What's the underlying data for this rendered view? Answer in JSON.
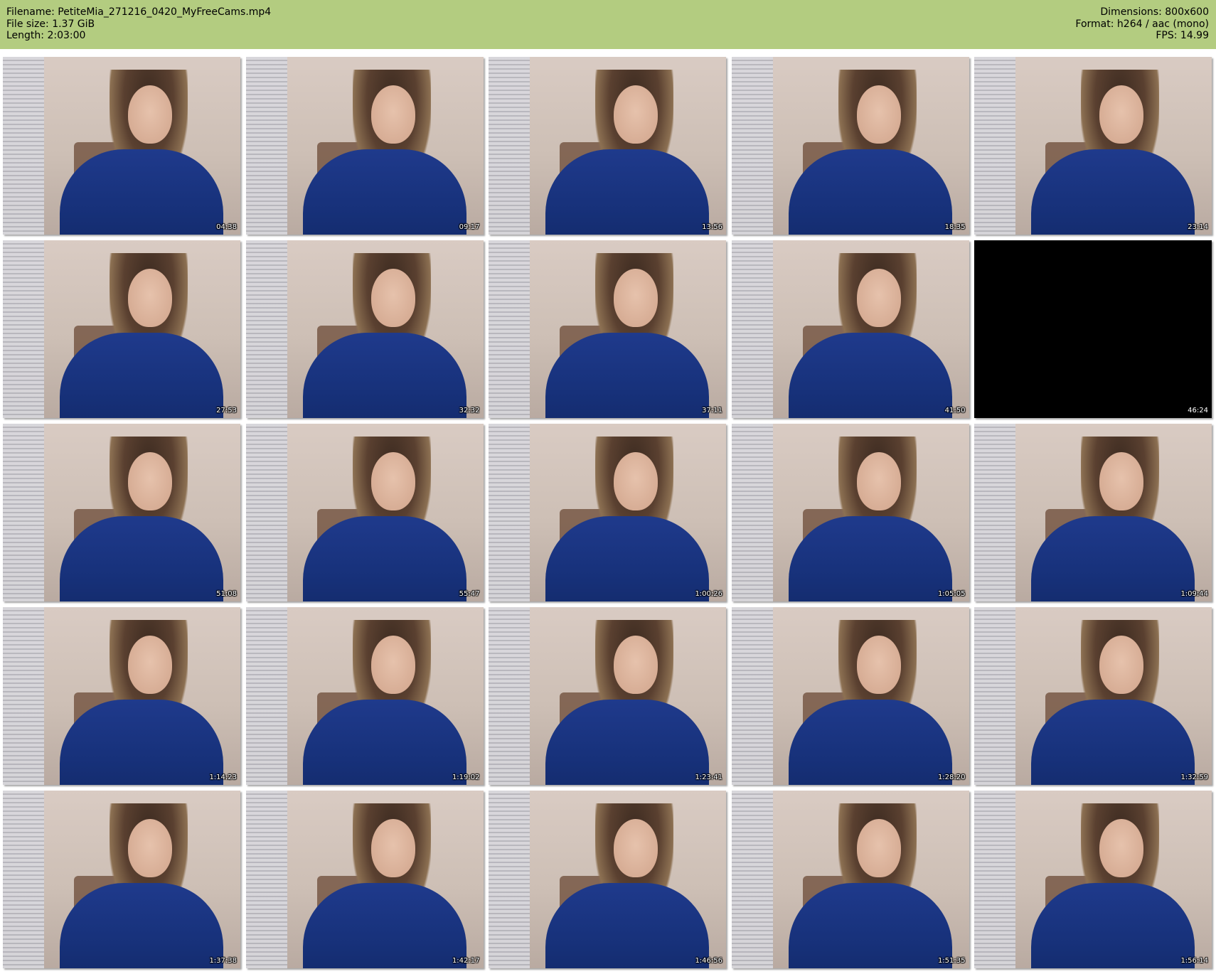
{
  "header": {
    "filename_label": "Filename: PetiteMia_271216_0420_MyFreeCams.mp4",
    "filesize_label": "File size: 1.37 GiB",
    "length_label": "Length: 2:03:00",
    "dimensions_label": "Dimensions: 800x600",
    "format_label": "Format: h264 / aac (mono)",
    "fps_label": "FPS: 14.99"
  },
  "colors": {
    "header_bg": "#b3cc80",
    "page_bg": "#ffffff"
  },
  "thumbnails": [
    {
      "timestamp": "04:38",
      "black": false
    },
    {
      "timestamp": "09:17",
      "black": false
    },
    {
      "timestamp": "13:56",
      "black": false
    },
    {
      "timestamp": "18:35",
      "black": false
    },
    {
      "timestamp": "23:14",
      "black": false
    },
    {
      "timestamp": "27:53",
      "black": false
    },
    {
      "timestamp": "32:32",
      "black": false
    },
    {
      "timestamp": "37:11",
      "black": false
    },
    {
      "timestamp": "41:50",
      "black": false
    },
    {
      "timestamp": "46:24",
      "black": true
    },
    {
      "timestamp": "51:08",
      "black": false
    },
    {
      "timestamp": "55:47",
      "black": false
    },
    {
      "timestamp": "1:00:26",
      "black": false
    },
    {
      "timestamp": "1:05:05",
      "black": false
    },
    {
      "timestamp": "1:09:44",
      "black": false
    },
    {
      "timestamp": "1:14:23",
      "black": false
    },
    {
      "timestamp": "1:19:02",
      "black": false
    },
    {
      "timestamp": "1:23:41",
      "black": false
    },
    {
      "timestamp": "1:28:20",
      "black": false
    },
    {
      "timestamp": "1:32:59",
      "black": false
    },
    {
      "timestamp": "1:37:38",
      "black": false
    },
    {
      "timestamp": "1:42:17",
      "black": false
    },
    {
      "timestamp": "1:46:56",
      "black": false
    },
    {
      "timestamp": "1:51:35",
      "black": false
    },
    {
      "timestamp": "1:56:14",
      "black": false
    }
  ]
}
